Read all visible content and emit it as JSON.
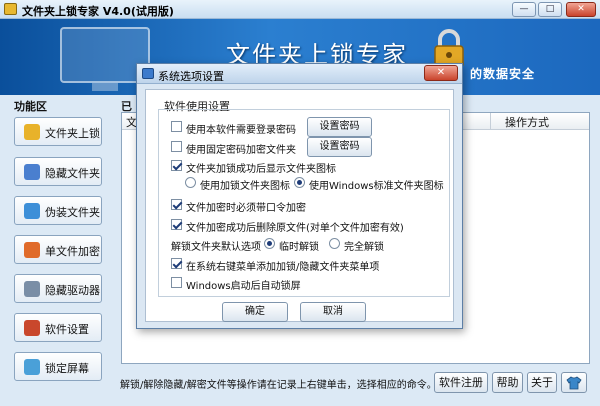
{
  "app": {
    "title": "文件夹上锁专家 V4.0(试用版)",
    "banner_title": "文件夹上锁专家",
    "banner_slogan": "的数据安全",
    "window_controls": {
      "minimize": "—",
      "maximize": "□",
      "close": "✕"
    }
  },
  "sidebar": {
    "title": "功能区",
    "items": [
      {
        "label": "文件夹上锁",
        "icon": "folder-lock-icon",
        "color": "#e8b22a"
      },
      {
        "label": "隐藏文件夹",
        "icon": "hidden-folder-icon",
        "color": "#4a7fcf"
      },
      {
        "label": "伪装文件夹",
        "icon": "disguise-folder-icon",
        "color": "#3d8fd8"
      },
      {
        "label": "单文件加密",
        "icon": "file-encrypt-icon",
        "color": "#e06b2a"
      },
      {
        "label": "隐藏驱动器",
        "icon": "hidden-drive-icon",
        "color": "#7a8ea6"
      },
      {
        "label": "软件设置",
        "icon": "settings-tools-icon",
        "color": "#c9472c"
      },
      {
        "label": "锁定屏幕",
        "icon": "lock-screen-icon",
        "color": "#4aa0d8"
      }
    ]
  },
  "main": {
    "panel_head": "已",
    "columns": [
      {
        "label": "文"
      },
      {
        "label": "操作方式"
      }
    ]
  },
  "statusbar": {
    "hint": "解锁/解除隐藏/解密文件等操作请在记录上右键单击，选择相应的命令。",
    "buttons": {
      "register": "软件注册",
      "help": "帮助",
      "about": "关于"
    }
  },
  "dialog": {
    "title": "系统选项设置",
    "group_title": "软件使用设置",
    "options": {
      "require_password": {
        "label": "使用本软件需要登录密码",
        "checked": false
      },
      "fixed_password": {
        "label": "使用固定密码加密文件夹",
        "checked": false
      },
      "show_icon_after_lock": {
        "label": "文件夹加锁成功后显示文件夹图标",
        "checked": true
      },
      "encrypt_needs_password": {
        "label": "文件加密时必须带口令加密",
        "checked": true
      },
      "delete_original": {
        "label": "文件加密成功后删除原文件(对单个文件加密有效)",
        "checked": true
      },
      "context_menu": {
        "label": "在系统右键菜单添加加锁/隐藏文件夹菜单项",
        "checked": true
      },
      "autolock_on_start": {
        "label": "Windows启动后自动锁屏",
        "checked": false
      }
    },
    "icon_choice": {
      "options": [
        {
          "label": "使用加锁文件夹图标",
          "checked": false
        },
        {
          "label": "使用Windows标准文件夹图标",
          "checked": true
        }
      ]
    },
    "unlock_default": {
      "label": "解锁文件夹默认选项",
      "options": [
        {
          "label": "临时解锁",
          "checked": true
        },
        {
          "label": "完全解锁",
          "checked": false
        }
      ]
    },
    "set_password_label_1": "设置密码",
    "set_password_label_2": "设置密码",
    "ok_label": "确定",
    "cancel_label": "取消",
    "close_label": "✕"
  }
}
